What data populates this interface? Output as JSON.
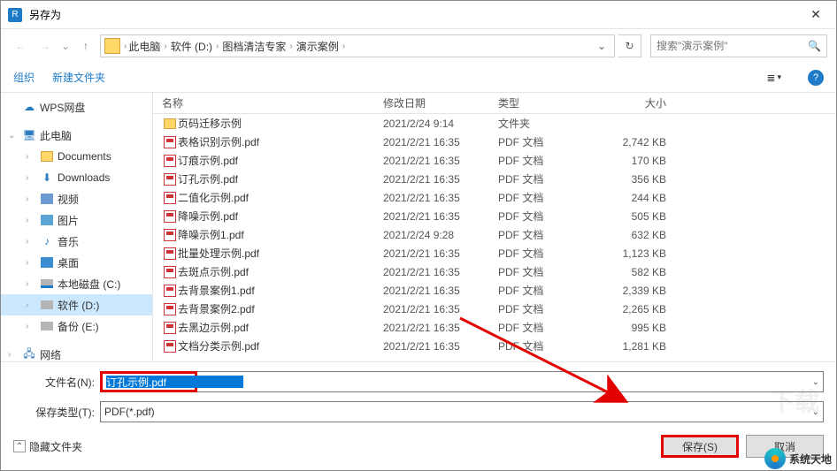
{
  "window": {
    "title": "另存为"
  },
  "breadcrumb": {
    "items": [
      "此电脑",
      "软件 (D:)",
      "图档清洁专家",
      "演示案例"
    ]
  },
  "search": {
    "placeholder": "搜索\"演示案例\""
  },
  "toolbar": {
    "organize": "组织",
    "newfolder": "新建文件夹"
  },
  "tree": {
    "wps": "WPS网盘",
    "pc": "此电脑",
    "docs": "Documents",
    "down": "Downloads",
    "vid": "视频",
    "pic": "图片",
    "music": "音乐",
    "desk": "桌面",
    "cdrive": "本地磁盘 (C:)",
    "ddrive": "软件 (D:)",
    "edrive": "备份 (E:)",
    "net": "网络"
  },
  "cols": {
    "name": "名称",
    "date": "修改日期",
    "type": "类型",
    "size": "大小"
  },
  "typelabels": {
    "folder": "文件夹",
    "pdf": "PDF 文档"
  },
  "files": [
    {
      "icon": "folder",
      "name": "页码迁移示例",
      "date": "2021/2/24 9:14",
      "typekey": "folder",
      "size": ""
    },
    {
      "icon": "pdf",
      "name": "表格识别示例.pdf",
      "date": "2021/2/21 16:35",
      "typekey": "pdf",
      "size": "2,742 KB"
    },
    {
      "icon": "pdf",
      "name": "订痕示例.pdf",
      "date": "2021/2/21 16:35",
      "typekey": "pdf",
      "size": "170 KB"
    },
    {
      "icon": "pdf",
      "name": "订孔示例.pdf",
      "date": "2021/2/21 16:35",
      "typekey": "pdf",
      "size": "356 KB"
    },
    {
      "icon": "pdf",
      "name": "二值化示例.pdf",
      "date": "2021/2/21 16:35",
      "typekey": "pdf",
      "size": "244 KB"
    },
    {
      "icon": "pdf",
      "name": "降噪示例.pdf",
      "date": "2021/2/21 16:35",
      "typekey": "pdf",
      "size": "505 KB"
    },
    {
      "icon": "pdf",
      "name": "降噪示例1.pdf",
      "date": "2021/2/24 9:28",
      "typekey": "pdf",
      "size": "632 KB"
    },
    {
      "icon": "pdf",
      "name": "批量处理示例.pdf",
      "date": "2021/2/21 16:35",
      "typekey": "pdf",
      "size": "1,123 KB"
    },
    {
      "icon": "pdf",
      "name": "去斑点示例.pdf",
      "date": "2021/2/21 16:35",
      "typekey": "pdf",
      "size": "582 KB"
    },
    {
      "icon": "pdf",
      "name": "去背景案例1.pdf",
      "date": "2021/2/21 16:35",
      "typekey": "pdf",
      "size": "2,339 KB"
    },
    {
      "icon": "pdf",
      "name": "去背景案例2.pdf",
      "date": "2021/2/21 16:35",
      "typekey": "pdf",
      "size": "2,265 KB"
    },
    {
      "icon": "pdf",
      "name": "去黑边示例.pdf",
      "date": "2021/2/21 16:35",
      "typekey": "pdf",
      "size": "995 KB"
    },
    {
      "icon": "pdf",
      "name": "文档分类示例.pdf",
      "date": "2021/2/21 16:35",
      "typekey": "pdf",
      "size": "1,281 KB"
    }
  ],
  "form": {
    "filename_label": "文件名(N):",
    "filename_value": "订孔示例.pdf",
    "type_label": "保存类型(T):",
    "type_value": "PDF(*.pdf)"
  },
  "buttons": {
    "hide": "隐藏文件夹",
    "save": "保存(S)",
    "cancel": "取消"
  },
  "brand": {
    "text": "系统天地"
  }
}
